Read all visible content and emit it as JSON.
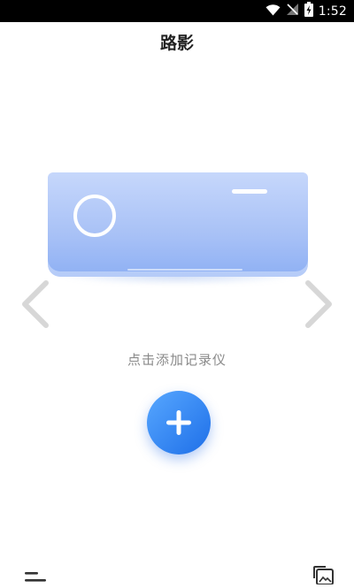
{
  "status_bar": {
    "time": "1:52",
    "icons": [
      "wifi-icon",
      "signal-off-icon",
      "battery-charging-icon"
    ]
  },
  "header": {
    "title": "路影"
  },
  "carousel": {
    "device_illustration": "air-conditioner-illustration",
    "prev_icon": "chevron-left-icon",
    "next_icon": "chevron-right-icon"
  },
  "main": {
    "hint_text": "点击添加记录仪",
    "add_icon": "plus-icon"
  },
  "bottom_bar": {
    "left_icon": "menu-icon",
    "right_icon": "gallery-icon"
  },
  "colors": {
    "accent": "#2f86f6",
    "device_body": "#a8c1f6",
    "hint_text": "#8a8a8a"
  }
}
